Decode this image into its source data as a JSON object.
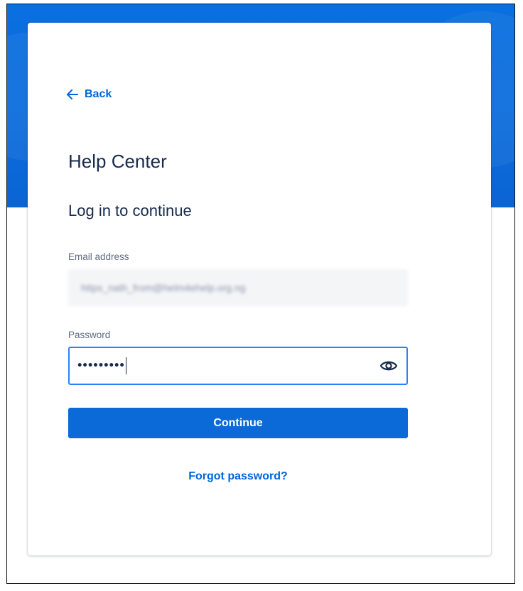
{
  "nav": {
    "back_label": "Back",
    "back_icon": "arrow-left-icon"
  },
  "site": {
    "title": "Help Center"
  },
  "form": {
    "heading": "Log in to continue",
    "email": {
      "label": "Email address",
      "value": "https_nath_from@helm4ehelp.org.ng"
    },
    "password": {
      "label": "Password",
      "value": "•••••••••",
      "toggle_icon": "eye-icon"
    },
    "submit_label": "Continue",
    "forgot_label": "Forgot password?"
  },
  "colors": {
    "brand_blue": "#0b6ad8",
    "link_blue": "#0065d8",
    "focus_border": "#2684ff",
    "heading_text": "#172b4d",
    "label_text": "#5e6c84"
  }
}
